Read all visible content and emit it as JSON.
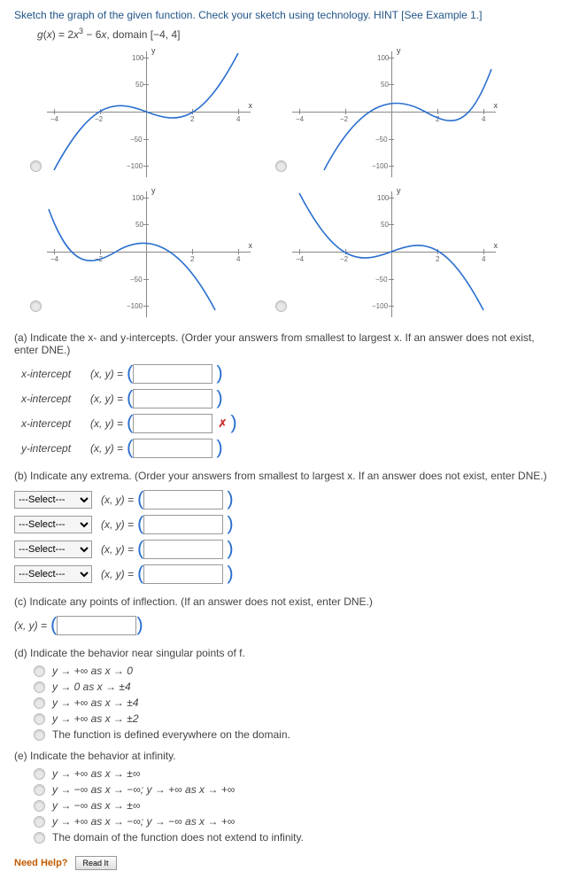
{
  "instructions": "Sketch the graph of the given function. Check your sketch using technology. HINT [See Example 1.]",
  "function_html": "g(x) = 2x³ − 6x, domain [−4, 4]",
  "chart_data": [
    {
      "type": "line",
      "xlim": [
        -4,
        4
      ],
      "ylim": [
        -100,
        100
      ],
      "xticks": [
        -4,
        -2,
        2,
        4
      ],
      "yticks": [
        -100,
        -50,
        50,
        100
      ],
      "xlabel": "x",
      "ylabel": "y",
      "variant": "cubic_up_origin"
    },
    {
      "type": "line",
      "xlim": [
        -4,
        4
      ],
      "ylim": [
        -100,
        100
      ],
      "xticks": [
        -4,
        -2,
        2,
        4
      ],
      "yticks": [
        -100,
        -50,
        50,
        100
      ],
      "xlabel": "x",
      "ylabel": "y",
      "variant": "cubic_up_shifted_right"
    },
    {
      "type": "line",
      "xlim": [
        -4,
        4
      ],
      "ylim": [
        -100,
        100
      ],
      "xticks": [
        -4,
        -2,
        2,
        4
      ],
      "yticks": [
        -100,
        -50,
        50,
        100
      ],
      "xlabel": "x",
      "ylabel": "y",
      "variant": "cubic_down_shifted_left"
    },
    {
      "type": "line",
      "xlim": [
        -4,
        4
      ],
      "ylim": [
        -100,
        100
      ],
      "xticks": [
        -4,
        -2,
        2,
        4
      ],
      "yticks": [
        -100,
        -50,
        50,
        100
      ],
      "xlabel": "x",
      "ylabel": "y",
      "variant": "cubic_down_origin"
    }
  ],
  "parts": {
    "a": {
      "prompt": "(a) Indicate the x- and y-intercepts. (Order your answers from smallest to largest x. If an answer does not exist, enter DNE.)",
      "rows": [
        {
          "label": "x-intercept",
          "xy": "(x, y) =",
          "status": ""
        },
        {
          "label": "x-intercept",
          "xy": "(x, y) =",
          "status": ""
        },
        {
          "label": "x-intercept",
          "xy": "(x, y) =",
          "status": "wrong"
        },
        {
          "label": "y-intercept",
          "xy": "(x, y) =",
          "status": ""
        }
      ]
    },
    "b": {
      "prompt": "(b) Indicate any extrema. (Order your answers from smallest to largest x. If an answer does not exist, enter DNE.)",
      "select_placeholder": "---Select---",
      "rows": [
        {
          "xy": "(x, y) ="
        },
        {
          "xy": "(x, y) ="
        },
        {
          "xy": "(x, y) ="
        },
        {
          "xy": "(x, y) ="
        }
      ]
    },
    "c": {
      "prompt": "(c) Indicate any points of inflection. (If an answer does not exist, enter DNE.)",
      "xy": "(x, y) ="
    },
    "d": {
      "prompt": "(d) Indicate the behavior near singular points of f.",
      "options": [
        "y → +∞ as x → 0",
        "y → 0 as x → ±4",
        "y → +∞ as x → ±4",
        "y → +∞ as x → ±2",
        "The function is defined everywhere on the domain."
      ]
    },
    "e": {
      "prompt": "(e) Indicate the behavior at infinity.",
      "options": [
        "y → +∞ as x → ±∞",
        "y → −∞ as x → −∞; y → +∞ as x → +∞",
        "y → −∞ as x → ±∞",
        "y → +∞ as x → −∞; y → −∞ as x → +∞",
        "The domain of the function does not extend to infinity."
      ]
    }
  },
  "help": {
    "label": "Need Help?",
    "button": "Read It"
  }
}
